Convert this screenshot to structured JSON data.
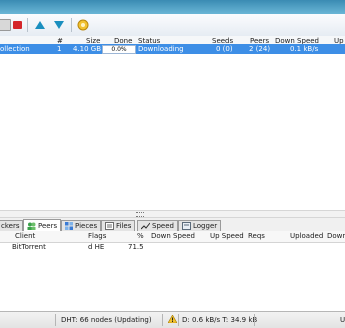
{
  "toolbar": {
    "buttons": [
      {
        "icon": "add-file-icon"
      },
      {
        "icon": "stop-icon"
      },
      {
        "icon": "move-up-icon"
      },
      {
        "icon": "move-down-icon"
      },
      {
        "icon": "preferences-icon"
      }
    ]
  },
  "torrent_columns": {
    "name": "",
    "num": "#",
    "size": "Size",
    "done": "Done",
    "status": "Status",
    "seeds": "Seeds",
    "peers": "Peers",
    "down_speed": "Down Speed",
    "up_speed": "Up"
  },
  "torrents": [
    {
      "name": "ollection",
      "num": "1",
      "size": "4.10 GB",
      "done": "0.0%",
      "status": "Downloading",
      "seeds": "0 (0)",
      "peers": "2 (24)",
      "down_speed": "0.1 kB/s"
    }
  ],
  "tabs": [
    {
      "label": "ckers",
      "icon": ""
    },
    {
      "label": "Peers",
      "icon": "peers-icon",
      "active": true
    },
    {
      "label": "Pieces",
      "icon": "pieces-icon"
    },
    {
      "label": "Files",
      "icon": "files-icon"
    },
    {
      "label": "Speed",
      "icon": "speed-icon"
    },
    {
      "label": "Logger",
      "icon": "logger-icon"
    }
  ],
  "peer_columns": {
    "client": "Client",
    "flags": "Flags",
    "percent": "%",
    "down_speed": "Down Speed",
    "up_speed": "Up Speed",
    "reqs": "Reqs",
    "uploaded": "Uploaded",
    "downloaded": "Down"
  },
  "peers": [
    {
      "client": "BitTorrent",
      "flags": "d HE",
      "percent": "71.5"
    }
  ],
  "statusbar": {
    "dht": "DHT: 66 nodes (Updating)",
    "transfer": "D: 0.6 kB/s T: 34.9 kB",
    "upload": "U"
  },
  "colors": {
    "selection": "#3d8ee6",
    "titlebar": "#4d9fc6"
  }
}
